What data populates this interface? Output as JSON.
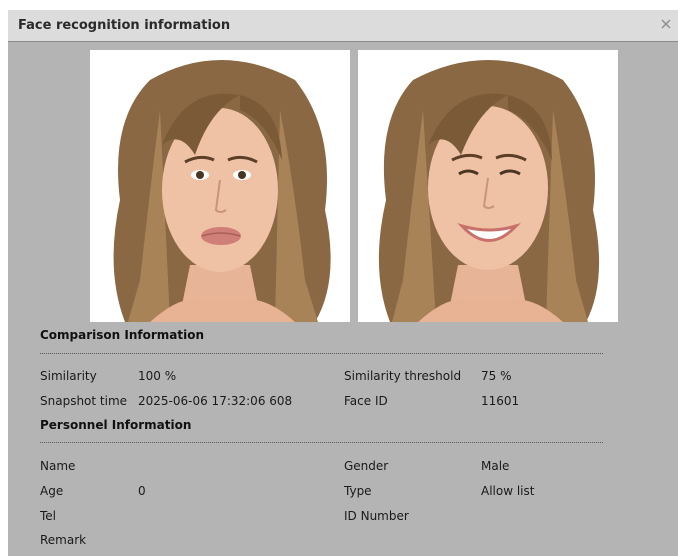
{
  "dialog": {
    "title": "Face recognition information",
    "close_icon": "close-icon"
  },
  "images": {
    "snapshot": "face-snapshot-photo",
    "library": "face-library-photo"
  },
  "comparison": {
    "heading": "Comparison Information",
    "similarity_label": "Similarity",
    "similarity_value": "100 %",
    "threshold_label": "Similarity threshold",
    "threshold_value": "75 %",
    "snapshot_time_label": "Snapshot time",
    "snapshot_time_value": "2025-06-06 17:32:06 608",
    "face_id_label": "Face ID",
    "face_id_value": "11601"
  },
  "personnel": {
    "heading": "Personnel Information",
    "name_label": "Name",
    "name_value": "",
    "gender_label": "Gender",
    "gender_value": "Male",
    "age_label": "Age",
    "age_value": "0",
    "type_label": "Type",
    "type_value": "Allow list",
    "tel_label": "Tel",
    "tel_value": "",
    "id_number_label": "ID Number",
    "id_number_value": "",
    "remark_label": "Remark",
    "remark_value": ""
  },
  "colors": {
    "dialog_bg": "#b4b4b4",
    "titlebar_bg": "#dcdcdc"
  }
}
